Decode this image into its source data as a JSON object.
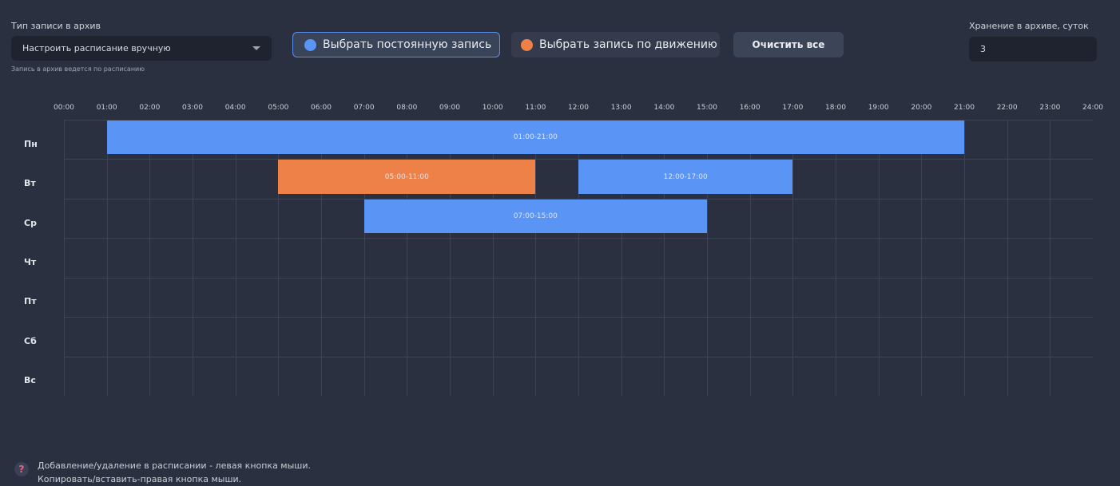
{
  "archive_type": {
    "label": "Тип записи в архив",
    "selected": "Настроить расписание вручную",
    "hint": "Запись в архив ведется по расписанию"
  },
  "buttons": {
    "permanent": "Выбрать постоянную запись",
    "motion": "Выбрать запись по движению",
    "clear": "Очистить все"
  },
  "storage": {
    "label": "Хранение в архиве, суток",
    "value": "3"
  },
  "colors": {
    "permanent": "#5a94f5",
    "motion": "#ee8147"
  },
  "hours": [
    "00:00",
    "01:00",
    "02:00",
    "03:00",
    "04:00",
    "05:00",
    "06:00",
    "07:00",
    "08:00",
    "09:00",
    "10:00",
    "11:00",
    "12:00",
    "13:00",
    "14:00",
    "15:00",
    "16:00",
    "17:00",
    "18:00",
    "19:00",
    "20:00",
    "21:00",
    "22:00",
    "23:00",
    "24:00"
  ],
  "days": [
    "Пн",
    "Вт",
    "Ср",
    "Чт",
    "Пт",
    "Сб",
    "Вс"
  ],
  "schedule": [
    {
      "day": 0,
      "start": 1,
      "end": 21,
      "type": "permanent",
      "label": "01:00-21:00"
    },
    {
      "day": 1,
      "start": 5,
      "end": 11,
      "type": "motion",
      "label": "05:00-11:00"
    },
    {
      "day": 1,
      "start": 12,
      "end": 17,
      "type": "permanent",
      "label": "12:00-17:00"
    },
    {
      "day": 2,
      "start": 7,
      "end": 15,
      "type": "permanent",
      "label": "07:00-15:00"
    }
  ],
  "help": {
    "line1": "Добавление/удаление в расписании - левая кнопка мыши.",
    "line2": "Копировать/вставить-правая кнопка мыши."
  }
}
